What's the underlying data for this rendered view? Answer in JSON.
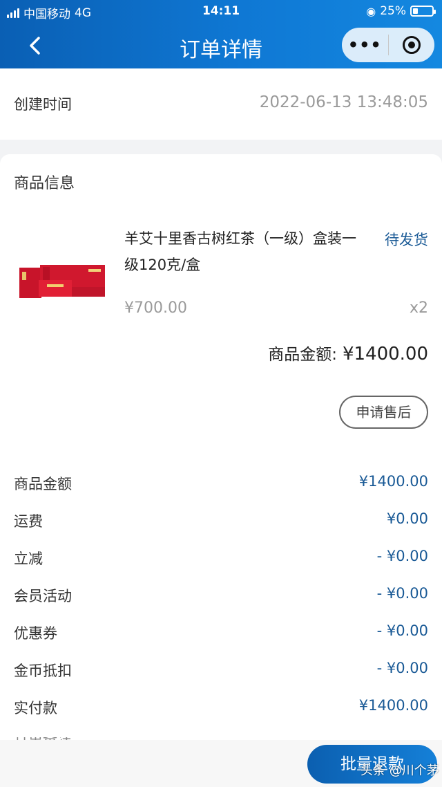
{
  "status_bar": {
    "carrier": "中国移动",
    "network": "4G",
    "time": "14:11",
    "battery": "25%"
  },
  "nav": {
    "title": "订单详情",
    "more_label": "•••"
  },
  "created": {
    "label": "创建时间",
    "value": "2022-06-13 13:48:05"
  },
  "product_section": {
    "title": "商品信息",
    "product_name": "羊艾十里香古树红茶（一级）盒装一级120克/盒",
    "status": "待发货",
    "price": "¥700.00",
    "quantity": "x2",
    "subtotal_label": "商品金额:",
    "subtotal_value": "¥1400.00",
    "aftersale_label": "申请售后"
  },
  "summary": [
    {
      "label": "商品金额",
      "value": "¥1400.00"
    },
    {
      "label": "运费",
      "value": "¥0.00"
    },
    {
      "label": "立减",
      "value": "- ¥0.00"
    },
    {
      "label": "会员活动",
      "value": "- ¥0.00"
    },
    {
      "label": "优惠券",
      "value": "- ¥0.00"
    },
    {
      "label": "金币抵扣",
      "value": "- ¥0.00"
    },
    {
      "label": "实付款",
      "value": "¥1400.00"
    }
  ],
  "partial_row_label": "订单备注",
  "bottom": {
    "batch_refund_label": "批量退款",
    "watermark": "头条 @川个茅"
  },
  "colors": {
    "header": "#0f78d4",
    "accent_text": "#1a5a96"
  }
}
